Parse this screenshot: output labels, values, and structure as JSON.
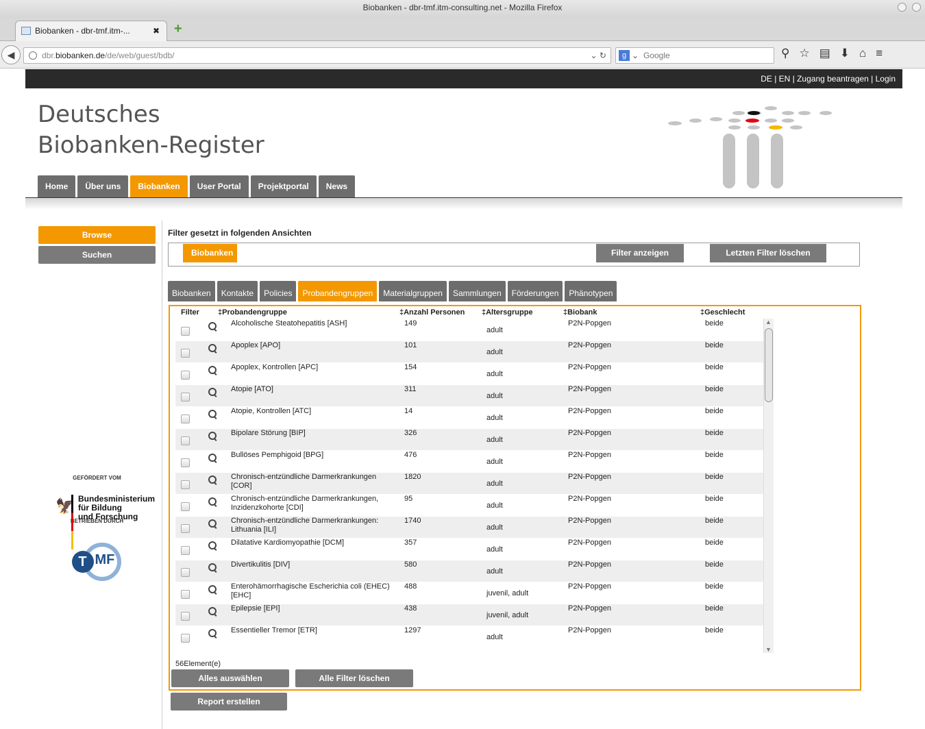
{
  "browser": {
    "window_title": "Biobanken - dbr-tmf.itm-consulting.net - Mozilla Firefox",
    "tab_title": "Biobanken - dbr-tmf.itm-...",
    "url_prefix": "dbr.",
    "url_domain": "biobanken.de",
    "url_path": "/de/web/guest/bdb/",
    "search_placeholder": "Google"
  },
  "site": {
    "top_links": "DE | EN | Zugang beantragen | Login",
    "title_line1": "Deutsches",
    "title_line2": "Biobanken-Register",
    "nav": [
      {
        "label": "Home"
      },
      {
        "label": "Über uns"
      },
      {
        "label": "Biobanken",
        "active": true
      },
      {
        "label": "User Portal"
      },
      {
        "label": "Projektportal"
      },
      {
        "label": "News"
      }
    ]
  },
  "sidebar": {
    "browse_label": "Browse",
    "search_label": "Suchen",
    "funded_by": "GEFÖRDERT VOM",
    "ministry_line1": "Bundesministerium",
    "ministry_line2": "für Bildung",
    "ministry_line3": "und Forschung",
    "operated_by": "BETRIEBEN DURCH",
    "tmf_t": "T",
    "tmf_mf": "MF"
  },
  "filter": {
    "heading": "Filter gesetzt in folgenden Ansichten",
    "tag": "Biobanken",
    "show_button": "Filter anzeigen",
    "clear_last_button": "Letzten Filter löschen"
  },
  "subtabs": [
    {
      "label": "Biobanken"
    },
    {
      "label": "Kontakte"
    },
    {
      "label": "Policies"
    },
    {
      "label": "Probandengruppen",
      "active": true
    },
    {
      "label": "Materialgruppen"
    },
    {
      "label": "Sammlungen"
    },
    {
      "label": "Förderungen"
    },
    {
      "label": "Phänotypen"
    }
  ],
  "grid": {
    "headers": {
      "filter": "Filter",
      "group": "‡Probandengruppe",
      "count": "‡Anzahl Personen",
      "age": "‡Altersgruppe",
      "biobank": "‡Biobank",
      "sex": "‡Geschlecht"
    },
    "rows": [
      {
        "name": "Alcoholische Steatohepatitis [ASH]",
        "count": "149",
        "age": "adult",
        "biobank": "P2N-Popgen",
        "sex": "beide"
      },
      {
        "name": "Apoplex [APO]",
        "count": "101",
        "age": "adult",
        "biobank": "P2N-Popgen",
        "sex": "beide"
      },
      {
        "name": "Apoplex, Kontrollen [APC]",
        "count": "154",
        "age": "adult",
        "biobank": "P2N-Popgen",
        "sex": "beide"
      },
      {
        "name": "Atopie [ATO]",
        "count": "311",
        "age": "adult",
        "biobank": "P2N-Popgen",
        "sex": "beide"
      },
      {
        "name": "Atopie, Kontrollen [ATC]",
        "count": "14",
        "age": "adult",
        "biobank": "P2N-Popgen",
        "sex": "beide"
      },
      {
        "name": "Bipolare Störung [BIP]",
        "count": "326",
        "age": "adult",
        "biobank": "P2N-Popgen",
        "sex": "beide"
      },
      {
        "name": "Bullöses Pemphigoid [BPG]",
        "count": "476",
        "age": "adult",
        "biobank": "P2N-Popgen",
        "sex": "beide"
      },
      {
        "name": "Chronisch-entzündliche Darmerkrankungen [COR]",
        "count": "1820",
        "age": "adult",
        "biobank": "P2N-Popgen",
        "sex": "beide"
      },
      {
        "name": "Chronisch-entzündliche Darmerkrankungen, Inzidenzkohorte [CDI]",
        "count": "95",
        "age": "adult",
        "biobank": "P2N-Popgen",
        "sex": "beide"
      },
      {
        "name": "Chronisch-entzündliche Darmerkrankungen: Lithuania [ILI]",
        "count": "1740",
        "age": "adult",
        "biobank": "P2N-Popgen",
        "sex": "beide"
      },
      {
        "name": "Dilatative Kardiomyopathie [DCM]",
        "count": "357",
        "age": "adult",
        "biobank": "P2N-Popgen",
        "sex": "beide"
      },
      {
        "name": "Divertikulitis [DIV]",
        "count": "580",
        "age": "adult",
        "biobank": "P2N-Popgen",
        "sex": "beide"
      },
      {
        "name": "Enterohämorrhagische Escherichia coli (EHEC) [EHC]",
        "count": "488",
        "age": "juvenil, adult",
        "biobank": "P2N-Popgen",
        "sex": "beide"
      },
      {
        "name": "Epilepsie [EPI]",
        "count": "438",
        "age": "juvenil, adult",
        "biobank": "P2N-Popgen",
        "sex": "beide"
      },
      {
        "name": "Essentieller Tremor [ETR]",
        "count": "1297",
        "age": "adult",
        "biobank": "P2N-Popgen",
        "sex": "beide"
      }
    ],
    "element_count": "56Element(e)",
    "select_all_button": "Alles auswählen",
    "clear_all_button": "Alle Filter löschen"
  },
  "report_button": "Report erstellen"
}
